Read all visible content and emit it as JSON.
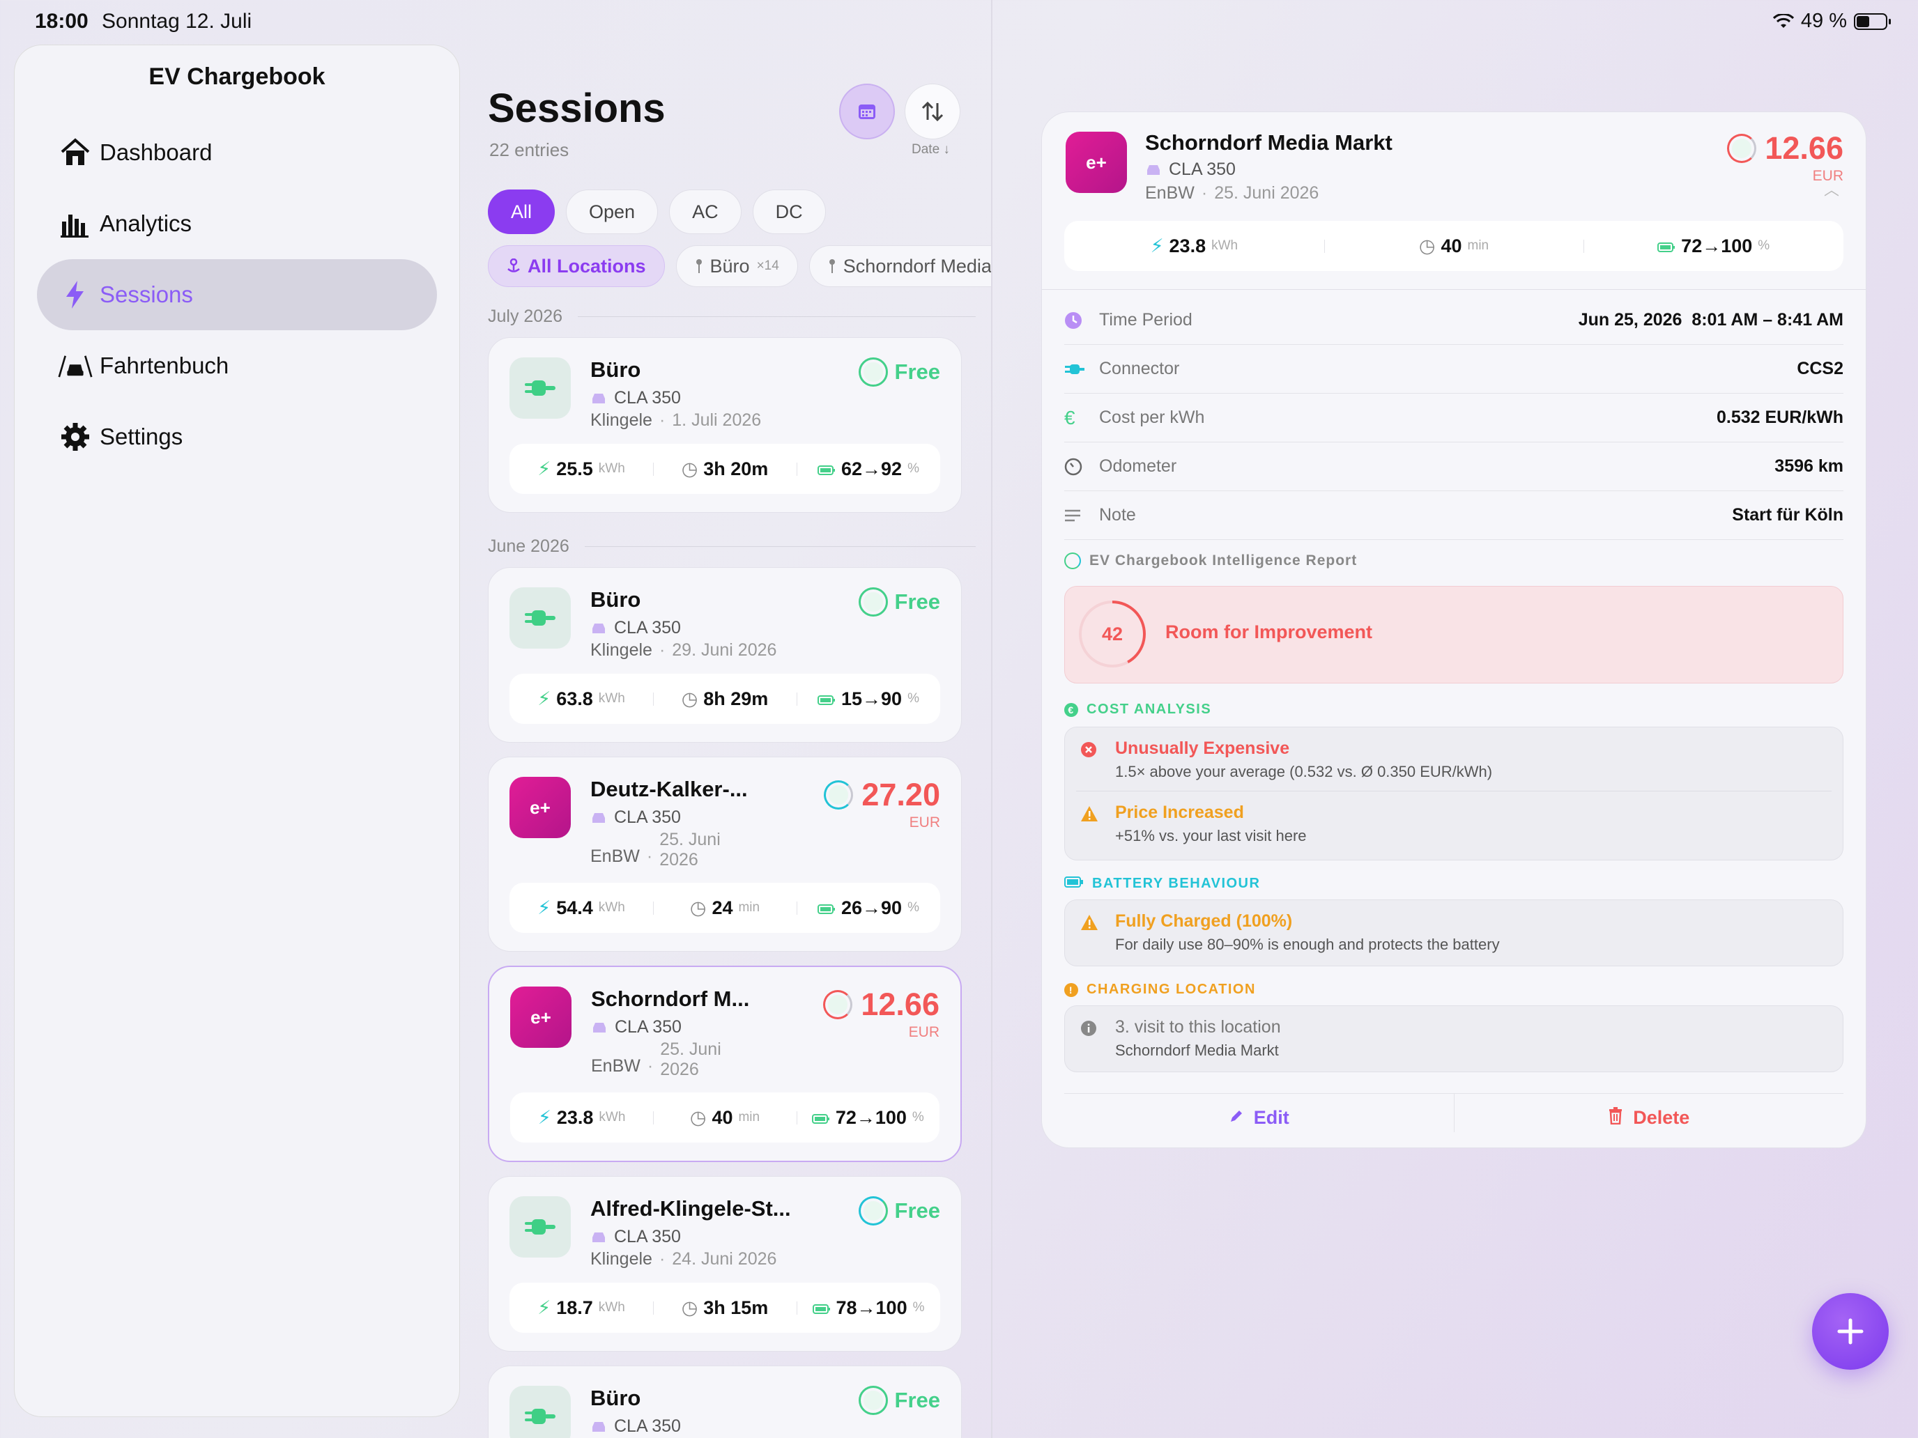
{
  "status": {
    "time": "18:00",
    "date": "Sonntag 12. Juli",
    "battery": "49 %"
  },
  "sidebar": {
    "title": "EV Chargebook",
    "items": [
      {
        "label": "Dashboard",
        "icon": "house-icon"
      },
      {
        "label": "Analytics",
        "icon": "bar-chart-icon"
      },
      {
        "label": "Sessions",
        "icon": "bolt-icon",
        "active": true
      },
      {
        "label": "Fahrtenbuch",
        "icon": "road-car-icon"
      },
      {
        "label": "Settings",
        "icon": "gear-icon"
      }
    ]
  },
  "list": {
    "title": "Sessions",
    "entries": "22 entries",
    "sort_label": "Date ↓",
    "filters": [
      "All",
      "Open",
      "AC",
      "DC"
    ],
    "locations": [
      {
        "label": "All Locations",
        "count": ""
      },
      {
        "label": "Büro",
        "count": "×14"
      },
      {
        "label": "Schorndorf Media Markt",
        "count": ""
      }
    ],
    "sections": [
      "July 2026",
      "June 2026"
    ],
    "cards": [
      {
        "title": "Büro",
        "car": "CLA 350",
        "provider": "Klingele",
        "date": "1. Juli 2026",
        "price": "Free",
        "currency": "",
        "energy": "25.5",
        "energy_unit": "kWh",
        "duration": "3h 20m",
        "duration_unit": "",
        "soc": "62→92",
        "soc_unit": "%"
      },
      {
        "title": "Büro",
        "car": "CLA 350",
        "provider": "Klingele",
        "date": "29. Juni 2026",
        "price": "Free",
        "currency": "",
        "energy": "63.8",
        "energy_unit": "kWh",
        "duration": "8h 29m",
        "duration_unit": "",
        "soc": "15→90",
        "soc_unit": "%"
      },
      {
        "title": "Deutz-Kalker-...",
        "car": "CLA 350",
        "provider": "EnBW",
        "date": "25. Juni 2026",
        "price": "27.20",
        "currency": "EUR",
        "energy": "54.4",
        "energy_unit": "kWh",
        "duration": "24",
        "duration_unit": "min",
        "soc": "26→90",
        "soc_unit": "%"
      },
      {
        "title": "Schorndorf M...",
        "car": "CLA 350",
        "provider": "EnBW",
        "date": "25. Juni 2026",
        "price": "12.66",
        "currency": "EUR",
        "energy": "23.8",
        "energy_unit": "kWh",
        "duration": "40",
        "duration_unit": "min",
        "soc": "72→100",
        "soc_unit": "%"
      },
      {
        "title": "Alfred-Klingele-St...",
        "car": "CLA 350",
        "provider": "Klingele",
        "date": "24. Juni 2026",
        "price": "Free",
        "currency": "",
        "energy": "18.7",
        "energy_unit": "kWh",
        "duration": "3h 15m",
        "duration_unit": "",
        "soc": "78→100",
        "soc_unit": "%"
      },
      {
        "title": "Büro",
        "car": "CLA 350",
        "provider": "",
        "date": "",
        "price": "Free",
        "currency": ""
      }
    ]
  },
  "detail": {
    "title": "Schorndorf Media Markt",
    "car": "CLA 350",
    "provider": "EnBW",
    "date": "25. Juni 2026",
    "price": "12.66",
    "currency": "EUR",
    "energy": "23.8",
    "energy_unit": "kWh",
    "duration": "40",
    "duration_unit": "min",
    "soc": "72→100",
    "soc_unit": "%",
    "rows": [
      {
        "label": "Time Period",
        "value": "Jun 25, 2026  8:01 AM – 8:41 AM",
        "icon": "clock-filled-icon"
      },
      {
        "label": "Connector",
        "value": "CCS2",
        "icon": "connector-icon"
      },
      {
        "label": "Cost per kWh",
        "value": "0.532 EUR/kWh",
        "icon": "euro-icon"
      },
      {
        "label": "Odometer",
        "value": "3596 km",
        "icon": "gauge-icon"
      },
      {
        "label": "Note",
        "value": "Start für Köln",
        "icon": "note-lines-icon"
      }
    ],
    "report_title": "EV Chargebook Intelligence Report",
    "score": "42",
    "score_label": "Room for Improvement",
    "cost_label": "COST ANALYSIS",
    "cost_items": [
      {
        "title": "Unusually Expensive",
        "sub": "1.5× above your average (0.532 vs. Ø 0.350 EUR/kWh)"
      },
      {
        "title": "Price Increased",
        "sub": "+51% vs. your last visit here"
      }
    ],
    "battery_label": "BATTERY BEHAVIOUR",
    "battery_item": {
      "title": "Fully Charged (100%)",
      "sub": "For daily use 80–90% is enough and protects the battery"
    },
    "location_label": "CHARGING LOCATION",
    "location_item": {
      "title": "3. visit to this location",
      "sub": "Schorndorf Media Markt"
    },
    "edit": "Edit",
    "delete": "Delete"
  },
  "colors": {
    "accent": "#8b5cf6",
    "free": "#44d08a",
    "price": "#f25757",
    "warning": "#f0a020",
    "info": "#22c3d6"
  }
}
